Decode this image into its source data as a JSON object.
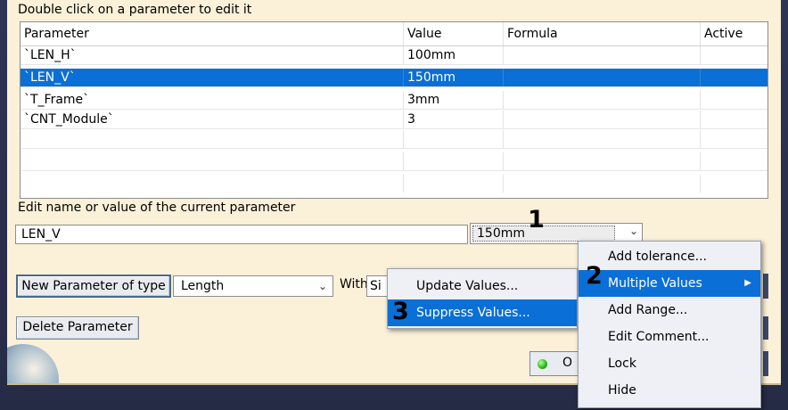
{
  "hint": "Double click on a parameter to edit it",
  "table": {
    "columns": [
      "Parameter",
      "Value",
      "Formula",
      "Active"
    ],
    "rows": [
      {
        "parameter": "`LEN_H`",
        "value": "100mm",
        "formula": "",
        "active": ""
      },
      {
        "parameter": "`LEN_V`",
        "value": "150mm",
        "formula": "",
        "active": ""
      },
      {
        "parameter": "`T_Frame`",
        "value": "3mm",
        "formula": "",
        "active": ""
      },
      {
        "parameter": "`CNT_Module`",
        "value": "3",
        "formula": "",
        "active": ""
      }
    ],
    "selected_row": 1
  },
  "edit_label": "Edit name or value of the current parameter",
  "name_field": "LEN_V",
  "value_field": "150mm",
  "new_param_button": "New Parameter of type",
  "type_select": "Length",
  "with_label": "With",
  "with_select": "Si",
  "delete_button": "Delete Parameter",
  "ok_button": "O",
  "left_menu": {
    "items": [
      "Update Values...",
      "Suppress Values..."
    ],
    "highlighted": 1
  },
  "right_menu": {
    "items": [
      "Add tolerance...",
      "Multiple Values",
      "Add Range...",
      "Edit Comment...",
      "Lock",
      "Hide"
    ],
    "highlighted": 1
  },
  "annotations": [
    "1",
    "2",
    "3"
  ],
  "colors": {
    "selection": "#0a6fd6",
    "dialog_bg": "#fbf0d8",
    "desktop": "#2e3454"
  }
}
